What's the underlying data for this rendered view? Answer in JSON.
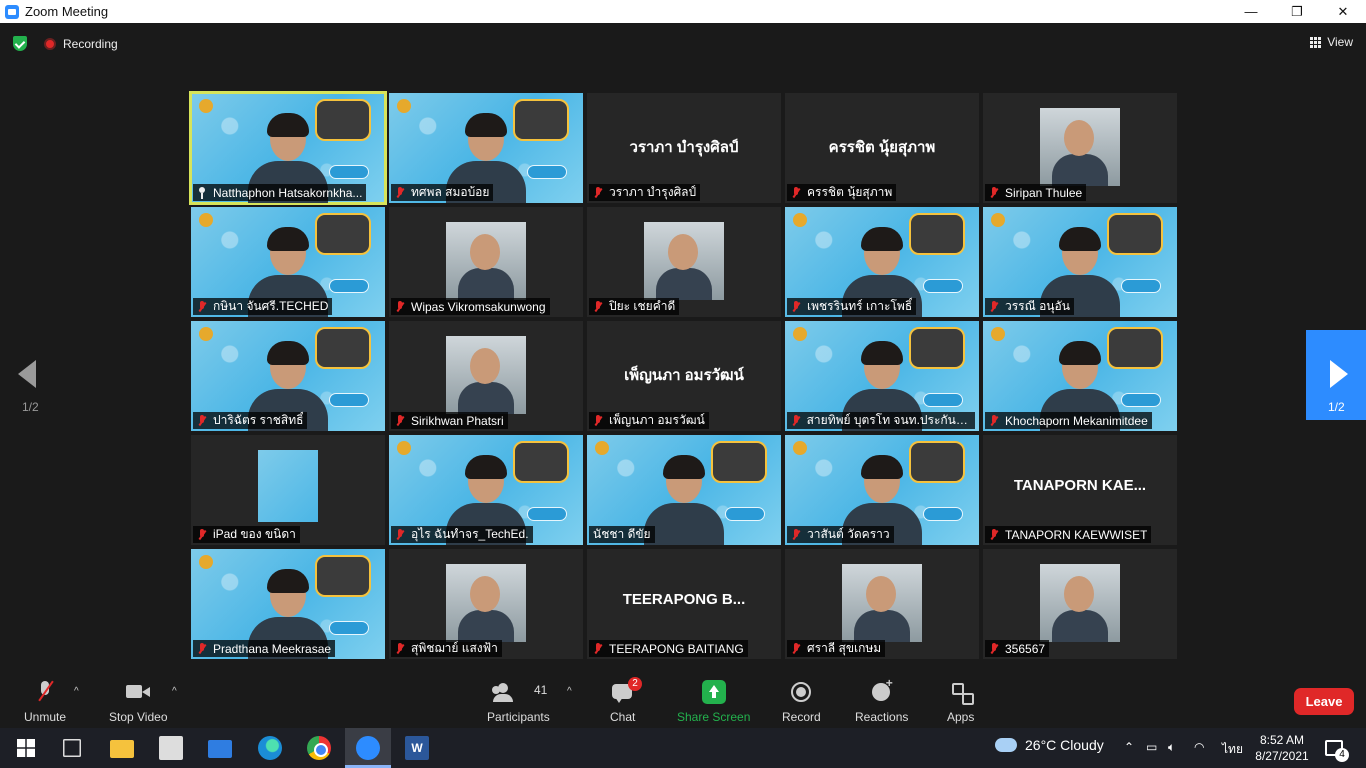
{
  "window": {
    "title": "Zoom Meeting",
    "minimize": "—",
    "restore": "❐",
    "close": "✕"
  },
  "topbar": {
    "recording_label": "Recording",
    "view_label": "View"
  },
  "pagination": {
    "left_page": "1/2",
    "right_page": "1/2"
  },
  "tiles": [
    {
      "name": "Natthaphon Hatsakornkha...",
      "bigname": "",
      "style": "video",
      "active": true,
      "icon": "pin"
    },
    {
      "name": "ทศพล สมอบ้อย",
      "bigname": "",
      "style": "video"
    },
    {
      "name": "วราภา บำรุงศิลป์",
      "bigname": "วราภา บำรุงศิลป์",
      "style": "text"
    },
    {
      "name": "ครรชิต นุ้ยสุภาพ",
      "bigname": "ครรชิต นุ้ยสุภาพ",
      "style": "text"
    },
    {
      "name": "Siripan Thulee",
      "bigname": "",
      "style": "photo"
    },
    {
      "name": "กษินา จันศรี.TECHED",
      "bigname": "",
      "style": "video"
    },
    {
      "name": "Wipas Vikromsakunwong",
      "bigname": "",
      "style": "photo"
    },
    {
      "name": "ปิยะ เชยคำดี",
      "bigname": "",
      "style": "photo"
    },
    {
      "name": "เพชรรินทร์ เกาะโพธิ์",
      "bigname": "",
      "style": "video"
    },
    {
      "name": "วรรณี อนุอัน",
      "bigname": "",
      "style": "video"
    },
    {
      "name": "ปาริฉัตร ราชสิทธิ์",
      "bigname": "",
      "style": "video"
    },
    {
      "name": "Sirikhwan Phatsri",
      "bigname": "",
      "style": "photo"
    },
    {
      "name": "เพ็ญนภา อมรวัฒน์",
      "bigname": "เพ็ญนภา อมรวัฒน์",
      "style": "text"
    },
    {
      "name": "สายทิพย์ บุตรโท จนท.ประกัน คอ.",
      "bigname": "",
      "style": "video"
    },
    {
      "name": "Khochaporn Mekanimitdee",
      "bigname": "",
      "style": "video"
    },
    {
      "name": "iPad ของ ขนิดา",
      "bigname": "",
      "style": "narrow"
    },
    {
      "name": "อุไร ฉันทำจร_TechEd.",
      "bigname": "",
      "style": "video"
    },
    {
      "name": "นัชชา ดีขัย",
      "bigname": "",
      "style": "video",
      "icon": "none"
    },
    {
      "name": "วาสันต์ วัดคราว",
      "bigname": "",
      "style": "video"
    },
    {
      "name": "TANAPORN KAEWWISET",
      "bigname": "TANAPORN KAE...",
      "style": "text"
    },
    {
      "name": "Pradthana Meekrasae",
      "bigname": "",
      "style": "video"
    },
    {
      "name": "สุพิชฌาย์ แสงฟ้า",
      "bigname": "",
      "style": "photo"
    },
    {
      "name": "TEERAPONG BAITIANG",
      "bigname": "TEERAPONG B...",
      "style": "text"
    },
    {
      "name": "ศราลี สุขเกษม",
      "bigname": "",
      "style": "photo"
    },
    {
      "name": "356567",
      "bigname": "",
      "style": "photo"
    }
  ],
  "toolbar": {
    "unmute": "Unmute",
    "stop_video": "Stop Video",
    "participants": "Participants",
    "participants_count": "41",
    "chat": "Chat",
    "chat_badge": "2",
    "share_screen": "Share Screen",
    "record": "Record",
    "reactions": "Reactions",
    "apps": "Apps",
    "leave": "Leave",
    "caret": "^"
  },
  "taskbar": {
    "word_label": "W",
    "temperature": "26°C",
    "condition": "Cloudy",
    "lang": "ไทย",
    "time": "8:52 AM",
    "date": "8/27/2021",
    "notifications": "4"
  },
  "colors": {
    "accent": "#2d8cff",
    "active_border": "#d7e45a",
    "leave": "#e02828",
    "share": "#23b14d"
  }
}
